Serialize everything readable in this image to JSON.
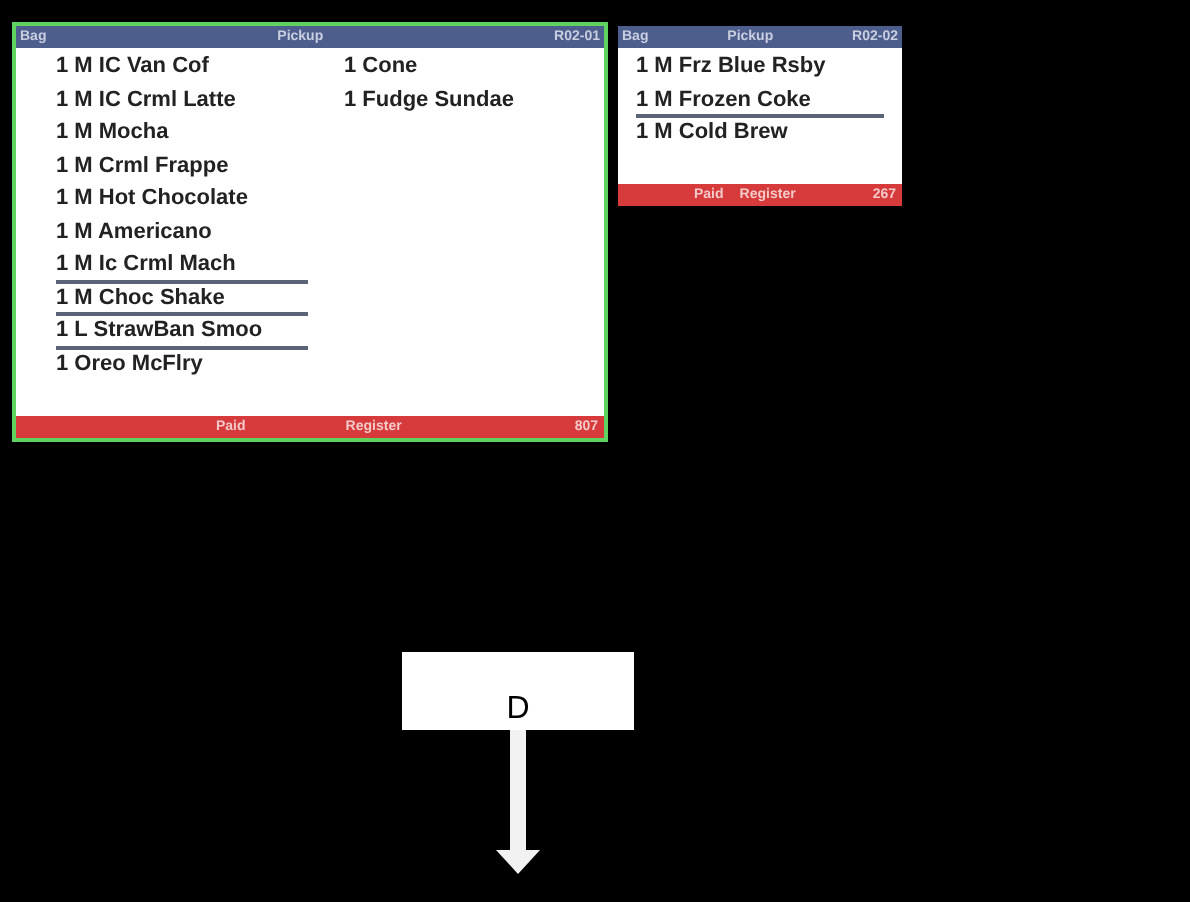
{
  "tickets": [
    {
      "selected": true,
      "header": {
        "label": "Bag",
        "destination": "Pickup",
        "order_id": "R02-01"
      },
      "columns": [
        [
          {
            "text": "1 M IC Van Cof",
            "divider_after": false
          },
          {
            "text": "1 M IC Crml Latte",
            "divider_after": false
          },
          {
            "text": "1 M Mocha",
            "divider_after": false
          },
          {
            "text": "1 M Crml Frappe",
            "divider_after": false
          },
          {
            "text": "1 M Hot Chocolate",
            "divider_after": false
          },
          {
            "text": "1 M Americano",
            "divider_after": false
          },
          {
            "text": "1 M Ic Crml Mach",
            "divider_after": true
          },
          {
            "text": "1 M Choc Shake",
            "divider_after": true
          },
          {
            "text": "1 L StrawBan Smoo",
            "divider_after": true
          },
          {
            "text": "1 Oreo McFlry",
            "divider_after": false
          }
        ],
        [
          {
            "text": "1 Cone",
            "divider_after": false
          },
          {
            "text": "1 Fudge Sundae",
            "divider_after": false
          }
        ]
      ],
      "footer": {
        "status": "Paid",
        "source": "Register",
        "number": "807"
      }
    },
    {
      "selected": false,
      "header": {
        "label": "Bag",
        "destination": "Pickup",
        "order_id": "R02-02"
      },
      "columns": [
        [
          {
            "text": "1 M Frz Blue Rsby",
            "divider_after": false
          },
          {
            "text": "1 M Frozen Coke",
            "divider_after": true
          },
          {
            "text": "1 M Cold Brew",
            "divider_after": false
          }
        ]
      ],
      "footer": {
        "status": "Paid",
        "source": "Register",
        "number": "267"
      }
    }
  ],
  "callout": {
    "label": "D"
  }
}
